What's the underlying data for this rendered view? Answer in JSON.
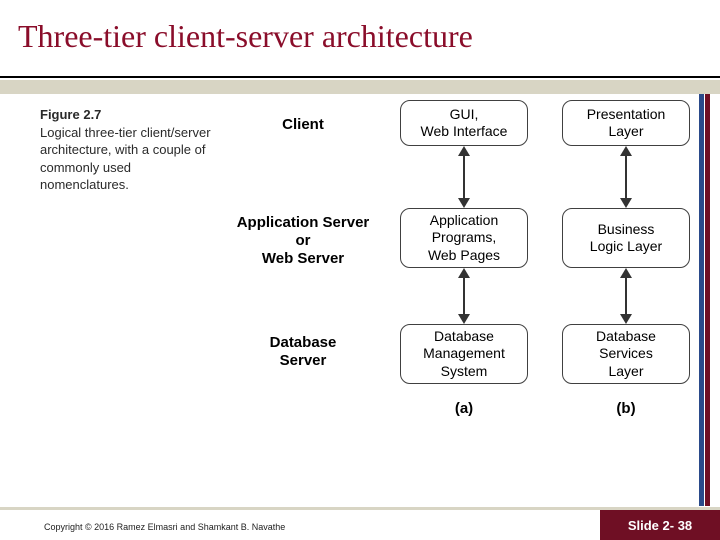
{
  "title": "Three-tier client-server architecture",
  "figure": {
    "label": "Figure 2.7",
    "caption": "Logical three-tier client/server architecture, with a couple of commonly used nomenclatures.",
    "row_labels": {
      "client": "Client",
      "app_server": "Application Server\nor\nWeb Server",
      "db_server": "Database\nServer"
    },
    "col_a": {
      "r1": "GUI,\nWeb Interface",
      "r2": "Application\nPrograms,\nWeb Pages",
      "r3": "Database\nManagement\nSystem",
      "caption": "(a)"
    },
    "col_b": {
      "r1": "Presentation\nLayer",
      "r2": "Business\nLogic Layer",
      "r3": "Database\nServices\nLayer",
      "caption": "(b)"
    }
  },
  "footer": {
    "copyright": "Copyright © 2016 Ramez Elmasri and Shamkant B. Navathe",
    "slide_number": "Slide 2- 38"
  }
}
